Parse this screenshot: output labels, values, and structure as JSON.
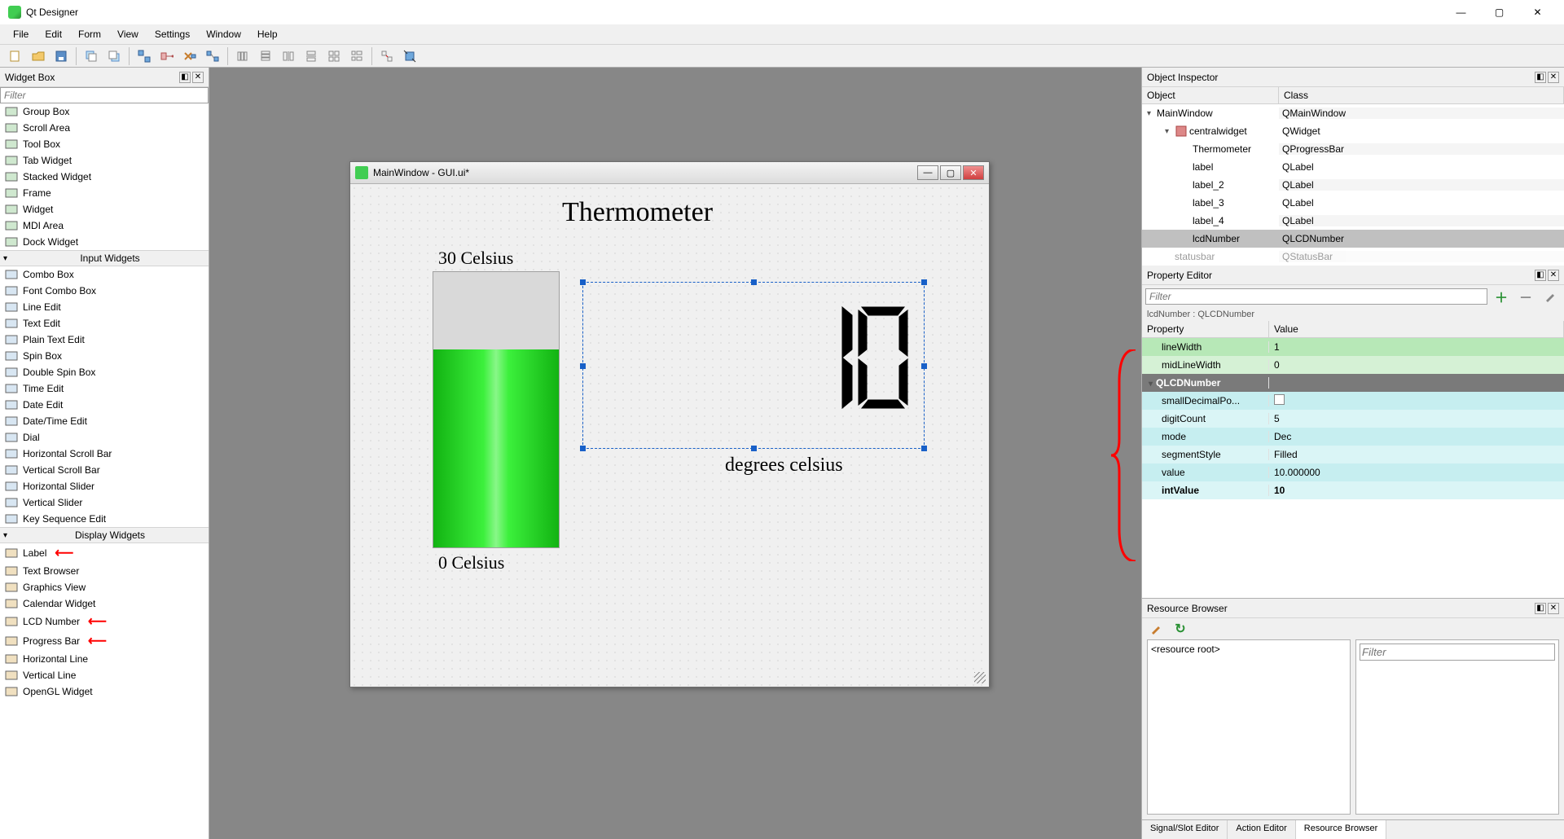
{
  "app": {
    "title": "Qt Designer"
  },
  "menu": [
    "File",
    "Edit",
    "Form",
    "View",
    "Settings",
    "Window",
    "Help"
  ],
  "widget_box": {
    "title": "Widget Box",
    "filter_placeholder": "Filter",
    "containers": [
      "Group Box",
      "Scroll Area",
      "Tool Box",
      "Tab Widget",
      "Stacked Widget",
      "Frame",
      "Widget",
      "MDI Area",
      "Dock Widget"
    ],
    "cat_input": "Input Widgets",
    "input": [
      "Combo Box",
      "Font Combo Box",
      "Line Edit",
      "Text Edit",
      "Plain Text Edit",
      "Spin Box",
      "Double Spin Box",
      "Time Edit",
      "Date Edit",
      "Date/Time Edit",
      "Dial",
      "Horizontal Scroll Bar",
      "Vertical Scroll Bar",
      "Horizontal Slider",
      "Vertical Slider",
      "Key Sequence Edit"
    ],
    "cat_display": "Display Widgets",
    "display": [
      "Label",
      "Text Browser",
      "Graphics View",
      "Calendar Widget",
      "LCD Number",
      "Progress Bar",
      "Horizontal Line",
      "Vertical Line",
      "OpenGL Widget"
    ]
  },
  "form": {
    "title": "MainWindow - GUI.ui*",
    "heading": "Thermometer",
    "top_label": "30 Celsius",
    "bottom_label": "0 Celsius",
    "unit_label": "degrees celsius",
    "lcd_value": "10"
  },
  "obj_inspector": {
    "title": "Object Inspector",
    "cols": {
      "obj": "Object",
      "cls": "Class"
    },
    "rows": [
      {
        "obj": "MainWindow",
        "cls": "QMainWindow",
        "indent": 0,
        "exp": "▾"
      },
      {
        "obj": "centralwidget",
        "cls": "QWidget",
        "indent": 1,
        "exp": "▾",
        "icon": true
      },
      {
        "obj": "Thermometer",
        "cls": "QProgressBar",
        "indent": 2
      },
      {
        "obj": "label",
        "cls": "QLabel",
        "indent": 2
      },
      {
        "obj": "label_2",
        "cls": "QLabel",
        "indent": 2
      },
      {
        "obj": "label_3",
        "cls": "QLabel",
        "indent": 2
      },
      {
        "obj": "label_4",
        "cls": "QLabel",
        "indent": 2
      },
      {
        "obj": "lcdNumber",
        "cls": "QLCDNumber",
        "indent": 2,
        "selected": true
      },
      {
        "obj": "statusbar",
        "cls": "QStatusBar",
        "indent": 1,
        "cut": true
      }
    ]
  },
  "prop_editor": {
    "title": "Property Editor",
    "filter_placeholder": "Filter",
    "context": "lcdNumber : QLCDNumber",
    "cols": {
      "p": "Property",
      "v": "Value"
    },
    "rows": [
      {
        "p": "lineWidth",
        "v": "1",
        "cls": "green"
      },
      {
        "p": "midLineWidth",
        "v": "0",
        "cls": "green2"
      },
      {
        "p": "QLCDNumber",
        "v": "",
        "cls": "gray",
        "bold": true,
        "exp": "▾"
      },
      {
        "p": "smallDecimalPo...",
        "v": "[checkbox]",
        "cls": "cyan"
      },
      {
        "p": "digitCount",
        "v": "5",
        "cls": "cyan2"
      },
      {
        "p": "mode",
        "v": "Dec",
        "cls": "cyan"
      },
      {
        "p": "segmentStyle",
        "v": "Filled",
        "cls": "cyan2"
      },
      {
        "p": "value",
        "v": "10.000000",
        "cls": "cyan"
      },
      {
        "p": "intValue",
        "v": "10",
        "cls": "cyan2",
        "bold": true
      }
    ]
  },
  "res_browser": {
    "title": "Resource Browser",
    "root": "<resource root>",
    "filter_placeholder": "Filter"
  },
  "tabs": [
    "Signal/Slot Editor",
    "Action Editor",
    "Resource Browser"
  ]
}
